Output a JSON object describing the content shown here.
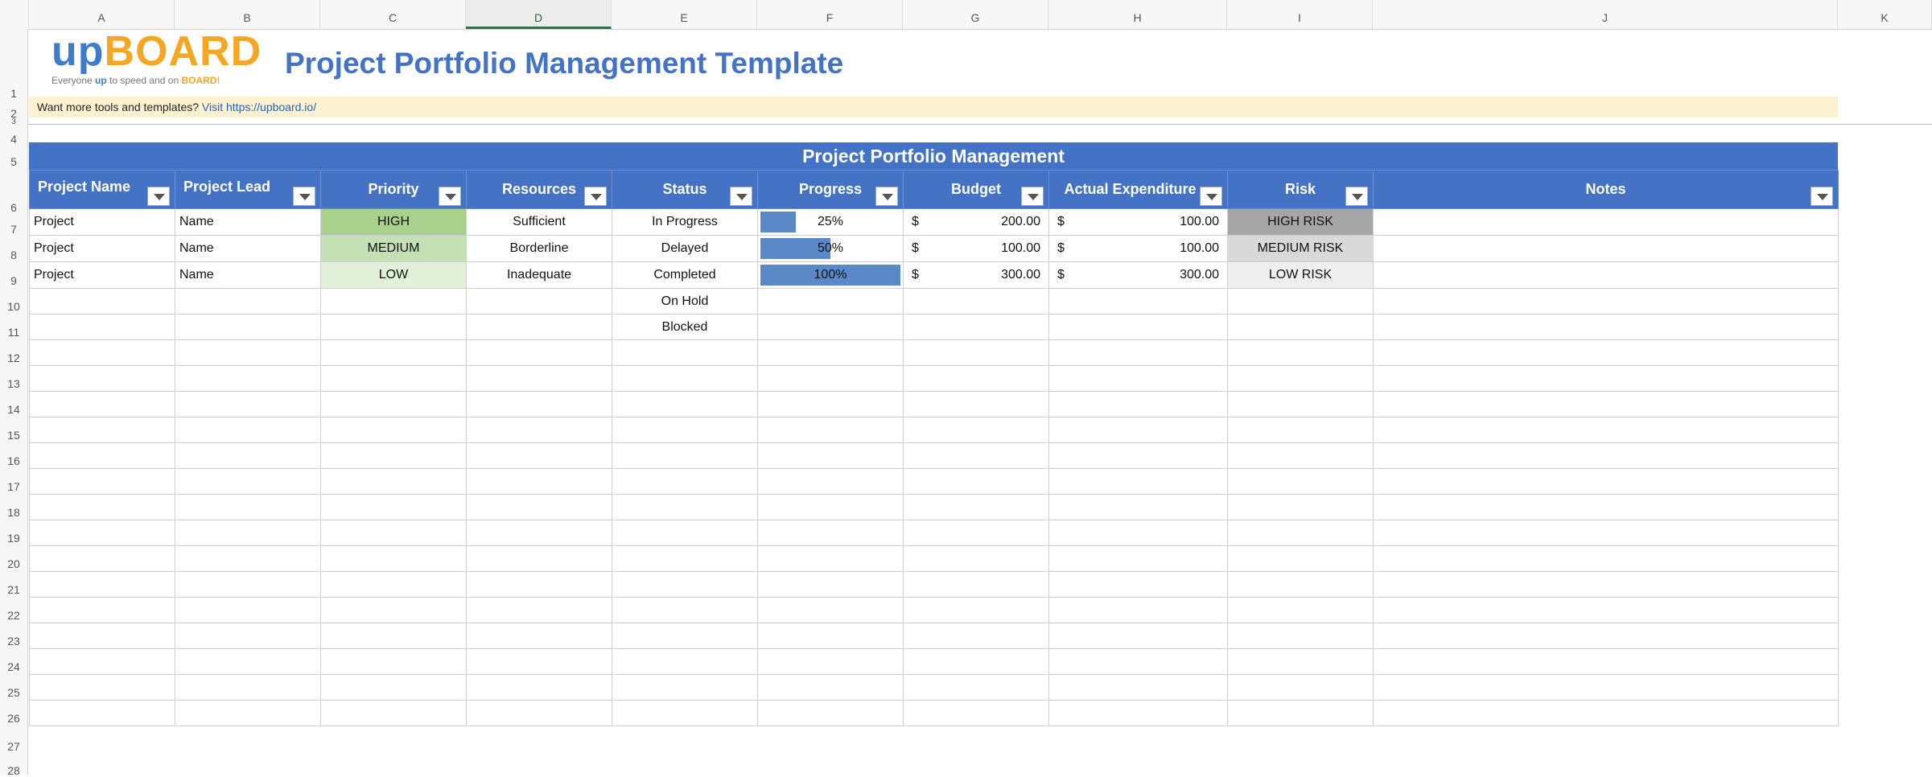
{
  "sheet": {
    "columns": [
      "A",
      "B",
      "C",
      "D",
      "E",
      "F",
      "G",
      "H",
      "I",
      "J",
      "K"
    ],
    "selected_column": "D",
    "rows": [
      "1",
      "2",
      "3",
      "4",
      "5",
      "6",
      "7",
      "8",
      "9",
      "10",
      "11",
      "12",
      "13",
      "14",
      "15",
      "16",
      "17",
      "18",
      "19",
      "20",
      "21",
      "22",
      "23",
      "24",
      "25",
      "26",
      "27",
      "28"
    ]
  },
  "logo": {
    "part1": "up",
    "part2": "BOARD",
    "tag_pre": "Everyone ",
    "tag_up": "up",
    "tag_mid": " to speed and on ",
    "tag_board": "BOARD!"
  },
  "title": "Project Portfolio Management Template",
  "promo": {
    "text": "Want more tools and templates?",
    "link": "Visit https://upboard.io/"
  },
  "banner": "Project Portfolio Management",
  "headers": [
    "Project Name",
    "Project Lead",
    "Priority",
    "Resources",
    "Status",
    "Progress",
    "Budget",
    "Actual Expenditure",
    "Risk",
    "Notes"
  ],
  "rows": [
    {
      "name": "Project",
      "lead": "Name",
      "priority": "HIGH",
      "resources": "Sufficient",
      "status": "In Progress",
      "progress": "25%",
      "progress_value": 0.25,
      "budget_cur": "$",
      "budget": "200.00",
      "actual_cur": "$",
      "actual": "100.00",
      "risk": "HIGH RISK",
      "notes": ""
    },
    {
      "name": "Project",
      "lead": "Name",
      "priority": "MEDIUM",
      "resources": "Borderline",
      "status": "Delayed",
      "progress": "50%",
      "progress_value": 0.5,
      "budget_cur": "$",
      "budget": "100.00",
      "actual_cur": "$",
      "actual": "100.00",
      "risk": "MEDIUM RISK",
      "notes": ""
    },
    {
      "name": "Project",
      "lead": "Name",
      "priority": "LOW",
      "resources": "Inadequate",
      "status": "Completed",
      "progress": "100%",
      "progress_value": 1.0,
      "budget_cur": "$",
      "budget": "300.00",
      "actual_cur": "$",
      "actual": "300.00",
      "risk": "LOW RISK",
      "notes": ""
    },
    {
      "name": "",
      "lead": "",
      "priority": "",
      "resources": "",
      "status": "On Hold",
      "progress": "",
      "progress_value": 0,
      "budget_cur": "",
      "budget": "",
      "actual_cur": "",
      "actual": "",
      "risk": "",
      "notes": ""
    },
    {
      "name": "",
      "lead": "",
      "priority": "",
      "resources": "",
      "status": "Blocked",
      "progress": "",
      "progress_value": 0,
      "budget_cur": "",
      "budget": "",
      "actual_cur": "",
      "actual": "",
      "risk": "",
      "notes": ""
    }
  ],
  "colors": {
    "header_blue": "#4472c4",
    "priority_high": "#a9d18e",
    "priority_medium": "#c5e0b4",
    "priority_low": "#e2f0d9",
    "risk_high": "#a6a6a6",
    "risk_medium": "#d9d9d9",
    "risk_low": "#efefef",
    "progress_fill": "#5b88c7"
  }
}
